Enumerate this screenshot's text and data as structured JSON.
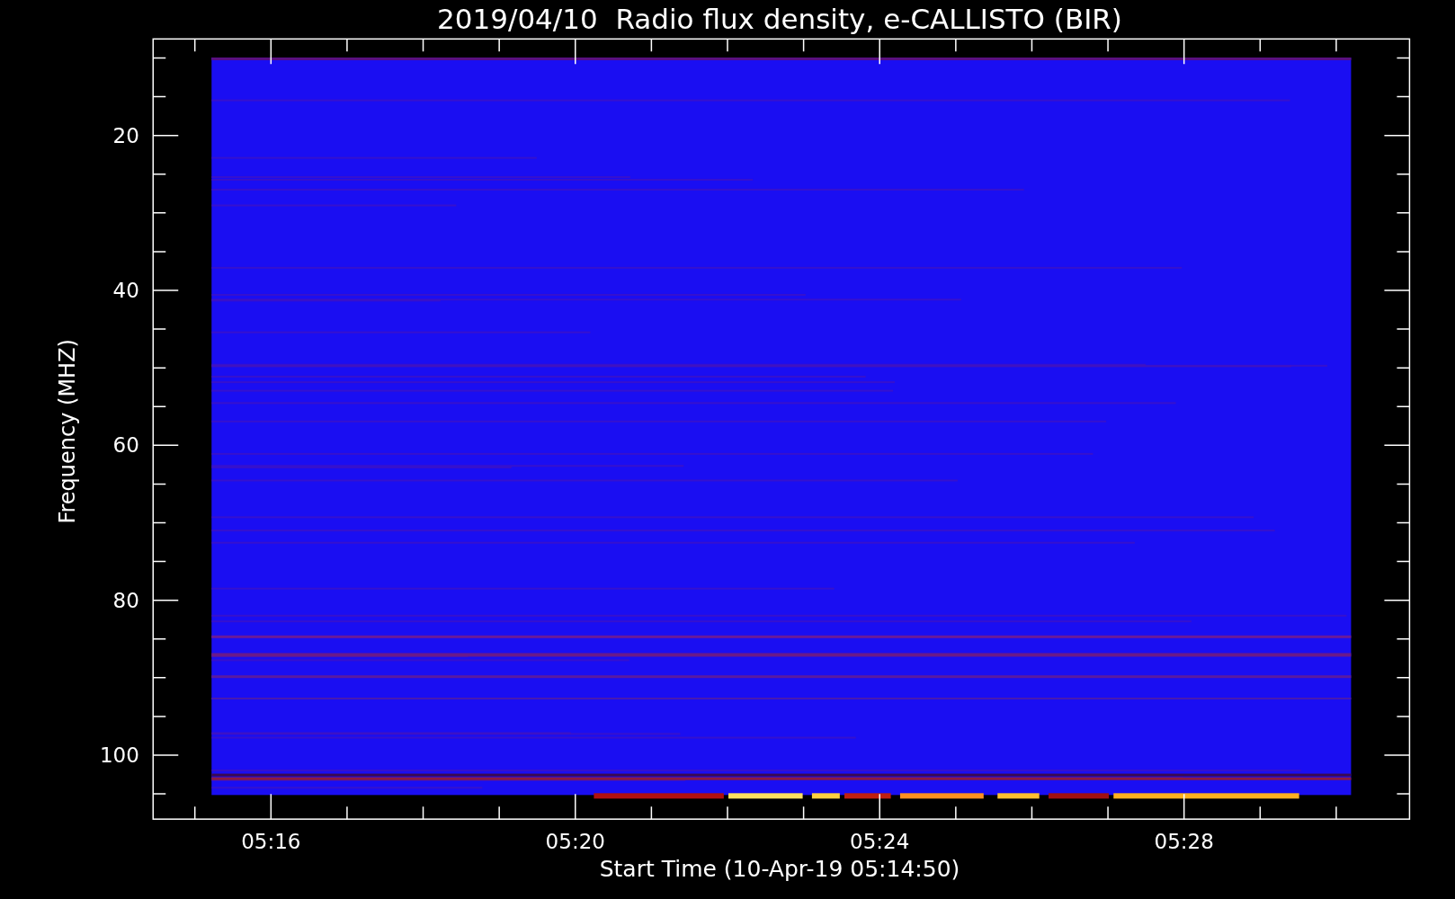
{
  "plot": {
    "title": "2019/04/10  Radio flux density, e-CALLISTO (BIR)",
    "xlabel": "Start Time (10-Apr-19 05:14:50)",
    "ylabel": "Frequency (MHZ)",
    "x_tick_labels": [
      "05:16",
      "05:20",
      "05:24",
      "05:28"
    ],
    "y_tick_labels": [
      "20",
      "40",
      "60",
      "80",
      "100"
    ]
  }
}
